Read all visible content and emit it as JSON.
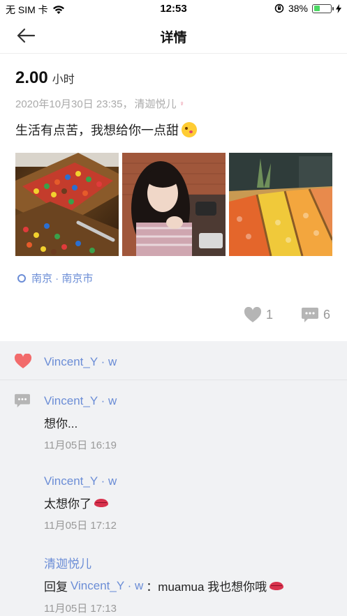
{
  "status_bar": {
    "carrier": "无 SIM 卡",
    "time": "12:53",
    "battery": "38%",
    "battery_level": 0.38
  },
  "nav": {
    "title": "详情"
  },
  "post": {
    "amount": "2.00",
    "unit": "小时",
    "datetime": "2020年10月30日 23:35，",
    "author": "清迦悦儿",
    "content": "生活有点苦，我想给你一点甜",
    "location": "南京 · 南京市",
    "like_count": "1",
    "comment_count": "6"
  },
  "colors": {
    "accent": "#6b8dd6",
    "like": "#f26b6b",
    "battery": "#4cd964"
  },
  "likes": {
    "user": "Vincent_Y · w"
  },
  "comments": [
    {
      "author": "Vincent_Y · w",
      "text": "想你...",
      "time": "11月05日 16:19"
    },
    {
      "author": "Vincent_Y · w",
      "text": "太想你了",
      "time": "11月05日 17:12"
    },
    {
      "author": "清迦悦儿",
      "reply_prefix": "回复",
      "reply_to": "Vincent_Y · w",
      "text": "：muamua 我也想你哦",
      "time": "11月05日 17:13"
    }
  ]
}
